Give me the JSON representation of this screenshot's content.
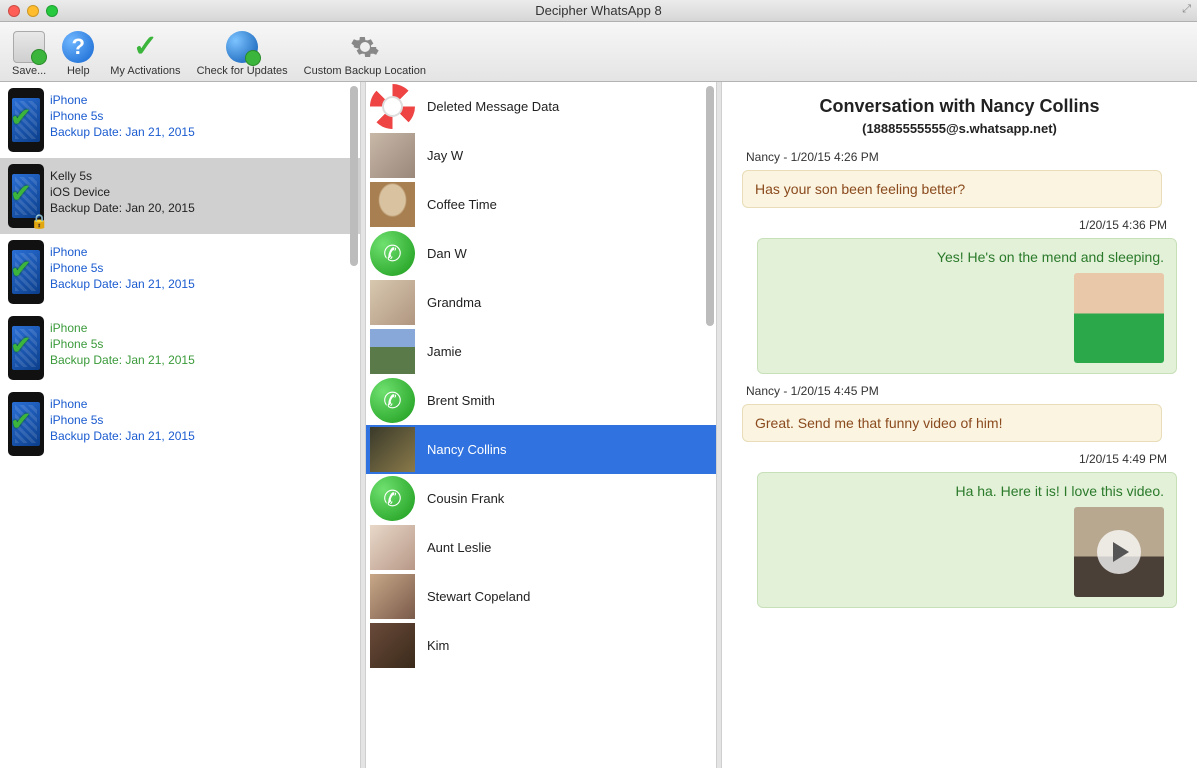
{
  "window": {
    "title": "Decipher WhatsApp 8"
  },
  "toolbar": {
    "save": "Save...",
    "help": "Help",
    "activations": "My Activations",
    "updates": "Check for Updates",
    "backup": "Custom Backup Location"
  },
  "devices": [
    {
      "name": "iPhone",
      "model": "iPhone 5s",
      "date": "Backup Date: Jan 21, 2015",
      "selected": false,
      "locked": false,
      "style": "blue"
    },
    {
      "name": "Kelly 5s",
      "model": "iOS Device",
      "date": "Backup Date: Jan 20, 2015",
      "selected": true,
      "locked": true,
      "style": "black"
    },
    {
      "name": "iPhone",
      "model": "iPhone 5s",
      "date": "Backup Date: Jan 21, 2015",
      "selected": false,
      "locked": false,
      "style": "blue"
    },
    {
      "name": "iPhone",
      "model": "iPhone 5s",
      "date": "Backup Date: Jan 21, 2015",
      "selected": false,
      "locked": false,
      "style": "green"
    },
    {
      "name": "iPhone",
      "model": "iPhone 5s",
      "date": "Backup Date: Jan 21, 2015",
      "selected": false,
      "locked": false,
      "style": "blue"
    }
  ],
  "contacts": [
    {
      "name": "Deleted Message Data",
      "icon": "lifebuoy",
      "selected": false
    },
    {
      "name": "Jay W",
      "icon": "person1",
      "selected": false
    },
    {
      "name": "Coffee Time",
      "icon": "coffee",
      "selected": false
    },
    {
      "name": "Dan W",
      "icon": "phone",
      "selected": false
    },
    {
      "name": "Grandma",
      "icon": "person2",
      "selected": false
    },
    {
      "name": "Jamie",
      "icon": "person3",
      "selected": false
    },
    {
      "name": "Brent Smith",
      "icon": "phone",
      "selected": false
    },
    {
      "name": "Nancy Collins",
      "icon": "person4",
      "selected": true
    },
    {
      "name": "Cousin Frank",
      "icon": "phone",
      "selected": false
    },
    {
      "name": "Aunt Leslie",
      "icon": "person5",
      "selected": false
    },
    {
      "name": "Stewart Copeland",
      "icon": "person6",
      "selected": false
    },
    {
      "name": "Kim",
      "icon": "person7",
      "selected": false
    }
  ],
  "conversation": {
    "title": "Conversation with Nancy Collins",
    "subtitle": "(18885555555@s.whatsapp.net)",
    "messages": [
      {
        "meta": "Nancy  - 1/20/15 4:26 PM",
        "dir": "in",
        "text": "Has your son been feeling better?"
      },
      {
        "meta": "1/20/15 4:36 PM",
        "dir": "out",
        "text": "Yes! He's on the mend and sleeping.",
        "attach": "kid"
      },
      {
        "meta": "Nancy  - 1/20/15  4:45 PM",
        "dir": "in",
        "text": "Great. Send me that funny video of him!"
      },
      {
        "meta": "1/20/15  4:49 PM",
        "dir": "out",
        "text": "Ha ha. Here it is! I love this video.",
        "attach": "video"
      }
    ]
  }
}
